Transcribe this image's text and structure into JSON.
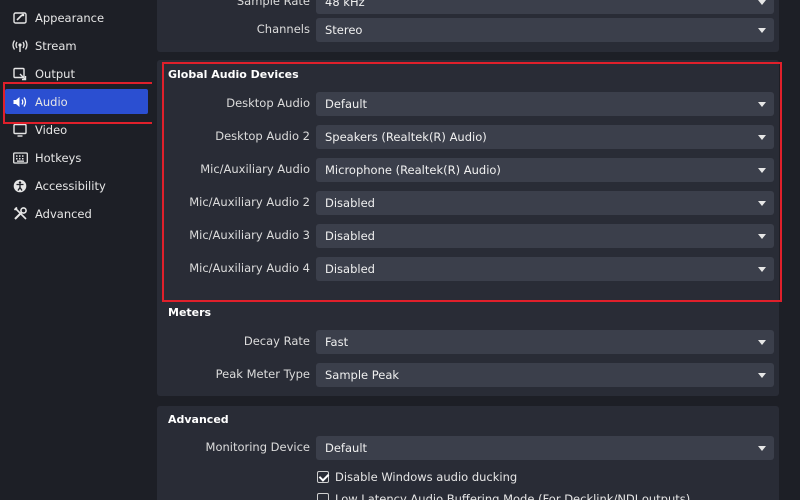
{
  "sidebar": {
    "items": [
      {
        "label": "Appearance",
        "icon": "appearance-icon",
        "active": false
      },
      {
        "label": "Stream",
        "icon": "stream-icon",
        "active": false
      },
      {
        "label": "Output",
        "icon": "output-icon",
        "active": false
      },
      {
        "label": "Audio",
        "icon": "audio-icon",
        "active": true
      },
      {
        "label": "Video",
        "icon": "video-icon",
        "active": false
      },
      {
        "label": "Hotkeys",
        "icon": "keyboard-icon",
        "active": false
      },
      {
        "label": "Accessibility",
        "icon": "accessibility-icon",
        "active": false
      },
      {
        "label": "Advanced",
        "icon": "advanced-icon",
        "active": false
      }
    ]
  },
  "general": {
    "sample_rate": {
      "label": "Sample Rate",
      "value": "48 kHz"
    },
    "channels": {
      "label": "Channels",
      "value": "Stereo"
    }
  },
  "global_audio": {
    "title": "Global Audio Devices",
    "rows": [
      {
        "label": "Desktop Audio",
        "value": "Default"
      },
      {
        "label": "Desktop Audio 2",
        "value": "Speakers (Realtek(R) Audio)"
      },
      {
        "label": "Mic/Auxiliary Audio",
        "value": "Microphone (Realtek(R) Audio)"
      },
      {
        "label": "Mic/Auxiliary Audio 2",
        "value": "Disabled"
      },
      {
        "label": "Mic/Auxiliary Audio 3",
        "value": "Disabled"
      },
      {
        "label": "Mic/Auxiliary Audio 4",
        "value": "Disabled"
      }
    ]
  },
  "meters": {
    "title": "Meters",
    "rows": [
      {
        "label": "Decay Rate",
        "value": "Fast"
      },
      {
        "label": "Peak Meter Type",
        "value": "Sample Peak"
      }
    ]
  },
  "advanced": {
    "title": "Advanced",
    "monitoring": {
      "label": "Monitoring Device",
      "value": "Default"
    },
    "ducking": {
      "label": "Disable Windows audio ducking",
      "checked": true
    },
    "low_latency": {
      "label": "Low Latency Audio Buffering Mode (For Decklink/NDI outputs)",
      "checked": false
    }
  },
  "colors": {
    "accent": "#2b4fd1",
    "highlight": "#e0202b",
    "panel": "#292c36",
    "background": "#1d1f26",
    "field": "#3b3f4b"
  }
}
